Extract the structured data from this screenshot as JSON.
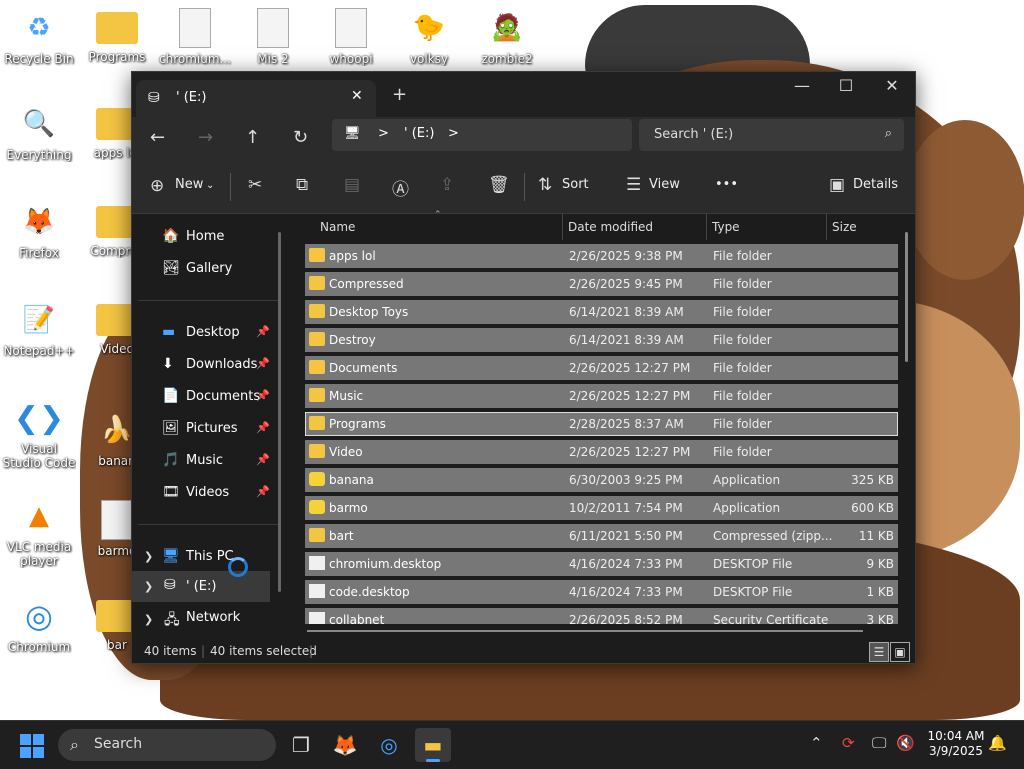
{
  "desktop": {
    "icons": [
      {
        "label": "Recycle Bin",
        "icon": "recycle-bin-icon",
        "glyph": "♻"
      },
      {
        "label": "Programs",
        "icon": "folder-icon",
        "glyph": ""
      },
      {
        "label": "chromium...",
        "icon": "file-icon",
        "glyph": ""
      },
      {
        "label": "Mis 2",
        "icon": "file-icon",
        "glyph": ""
      },
      {
        "label": "whoopi",
        "icon": "file-icon",
        "glyph": ""
      },
      {
        "label": "volksy",
        "icon": "duck-icon",
        "glyph": "🐤"
      },
      {
        "label": "zombie2",
        "icon": "zombie-icon",
        "glyph": "🧟"
      },
      {
        "label": "Everything",
        "icon": "everything-search-icon",
        "glyph": "🔍"
      },
      {
        "label": "apps lol",
        "icon": "folder-icon",
        "glyph": ""
      },
      {
        "label": "Firefox",
        "icon": "firefox-icon",
        "glyph": "🦊"
      },
      {
        "label": "Compres",
        "icon": "folder-icon",
        "glyph": ""
      },
      {
        "label": "Notepad++",
        "icon": "notepadpp-icon",
        "glyph": "📝"
      },
      {
        "label": "Video",
        "icon": "folder-icon",
        "glyph": ""
      },
      {
        "label": "Visual Studio Code",
        "icon": "vscode-icon",
        "glyph": "⌘"
      },
      {
        "label": "banan",
        "icon": "banana-icon",
        "glyph": "🍌"
      },
      {
        "label": "VLC media player",
        "icon": "vlc-icon",
        "glyph": "🔶"
      },
      {
        "label": "barmo",
        "icon": "file-icon",
        "glyph": ""
      },
      {
        "label": "Chromium",
        "icon": "chromium-icon",
        "glyph": "◎"
      },
      {
        "label": "bar",
        "icon": "zip-folder-icon",
        "glyph": ""
      }
    ]
  },
  "window": {
    "tab_title": "' (E:)",
    "new_tab": "+",
    "controls": {
      "minimize": "—",
      "maximize": "☐",
      "close": "✕"
    },
    "address": {
      "pc_glyph": "🖥",
      "sep1": ">",
      "location": "' (E:)",
      "sep2": ">"
    },
    "search_placeholder": "Search ' (E:)",
    "toolbar": {
      "new": "New",
      "sort": "Sort",
      "view": "View",
      "more": "•••",
      "details": "Details"
    },
    "nav": {
      "home": "Home",
      "gallery": "Gallery",
      "pinned": [
        {
          "label": "Desktop",
          "icon": "desktop-icon",
          "glyph": "🟦"
        },
        {
          "label": "Downloads",
          "icon": "downloads-icon",
          "glyph": "⬇"
        },
        {
          "label": "Documents",
          "icon": "documents-icon",
          "glyph": "📄"
        },
        {
          "label": "Pictures",
          "icon": "pictures-icon",
          "glyph": "🖼"
        },
        {
          "label": "Music",
          "icon": "music-icon",
          "glyph": "🎵"
        },
        {
          "label": "Videos",
          "icon": "videos-icon",
          "glyph": "🎞"
        }
      ],
      "this_pc": "This PC",
      "drive": "' (E:)",
      "network": "Network"
    },
    "columns": {
      "name": "Name",
      "date": "Date modified",
      "type": "Type",
      "size": "Size"
    },
    "files": [
      {
        "name": "apps lol",
        "date": "2/26/2025 9:38 PM",
        "type": "File folder",
        "size": "",
        "kind": "folder"
      },
      {
        "name": "Compressed",
        "date": "2/26/2025 9:45 PM",
        "type": "File folder",
        "size": "",
        "kind": "folder"
      },
      {
        "name": "Desktop Toys",
        "date": "6/14/2021 8:39 AM",
        "type": "File folder",
        "size": "",
        "kind": "folder"
      },
      {
        "name": "Destroy",
        "date": "6/14/2021 8:39 AM",
        "type": "File folder",
        "size": "",
        "kind": "folder"
      },
      {
        "name": "Documents",
        "date": "2/26/2025 12:27 PM",
        "type": "File folder",
        "size": "",
        "kind": "folder"
      },
      {
        "name": "Music",
        "date": "2/26/2025 12:27 PM",
        "type": "File folder",
        "size": "",
        "kind": "folder"
      },
      {
        "name": "Programs",
        "date": "2/28/2025 8:37 AM",
        "type": "File folder",
        "size": "",
        "kind": "folder"
      },
      {
        "name": "Video",
        "date": "2/26/2025 12:27 PM",
        "type": "File folder",
        "size": "",
        "kind": "folder"
      },
      {
        "name": "banana",
        "date": "6/30/2003 9:25 PM",
        "type": "Application",
        "size": "325 KB",
        "kind": "app"
      },
      {
        "name": "barmo",
        "date": "10/2/2011 7:54 PM",
        "type": "Application",
        "size": "600 KB",
        "kind": "app"
      },
      {
        "name": "bart",
        "date": "6/11/2021 5:50 PM",
        "type": "Compressed (zipp...",
        "size": "11 KB",
        "kind": "folder"
      },
      {
        "name": "chromium.desktop",
        "date": "4/16/2024 7:33 PM",
        "type": "DESKTOP File",
        "size": "9 KB",
        "kind": "file"
      },
      {
        "name": "code.desktop",
        "date": "4/16/2024 7:33 PM",
        "type": "DESKTOP File",
        "size": "1 KB",
        "kind": "file"
      },
      {
        "name": "collabnet",
        "date": "2/26/2025 8:52 PM",
        "type": "Security Certificate",
        "size": "3 KB",
        "kind": "file"
      }
    ],
    "status": {
      "count": "40 items",
      "selected": "40 items selected"
    }
  },
  "taskbar": {
    "search": "Search",
    "clock_time": "10:04 AM",
    "clock_date": "3/9/2025",
    "accent": "#4aa3ff"
  }
}
